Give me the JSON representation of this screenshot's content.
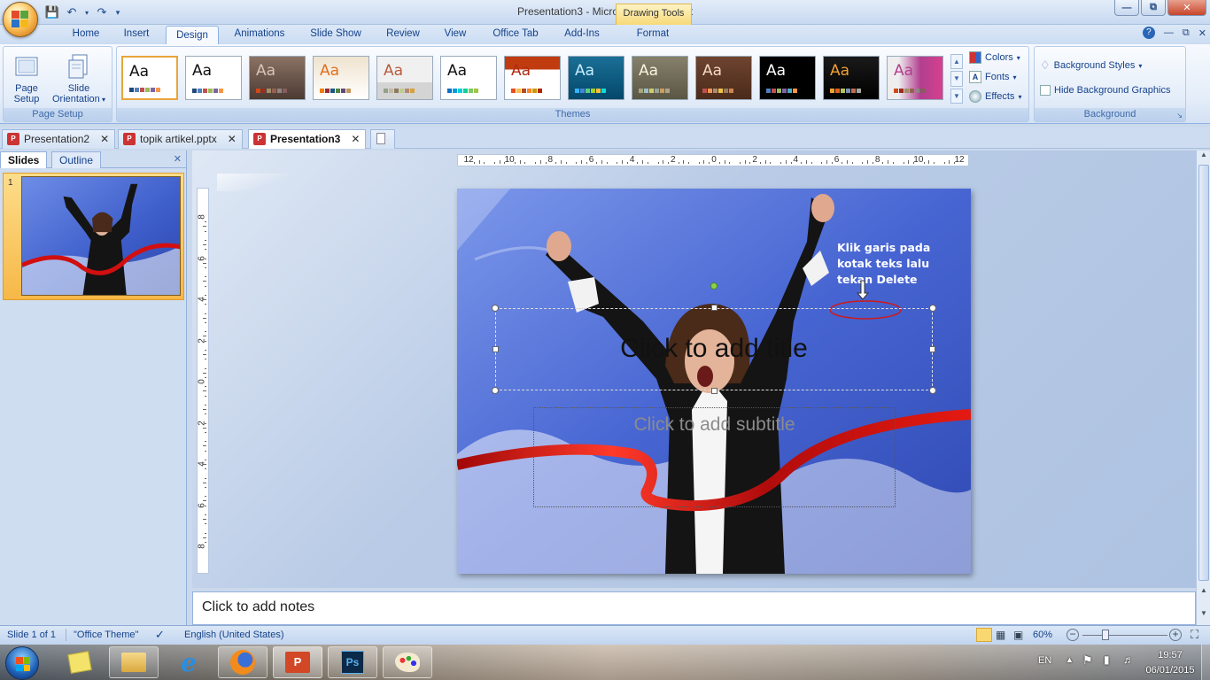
{
  "window": {
    "title": "Presentation3 - Microsoft PowerPoint",
    "contextual_header": "Drawing Tools"
  },
  "ribbon_tabs": [
    "Home",
    "Insert",
    "Design",
    "Animations",
    "Slide Show",
    "Review",
    "View",
    "Office Tab",
    "Add-Ins",
    "Format"
  ],
  "active_tab": "Design",
  "page_setup": {
    "page_setup_label": "Page Setup",
    "slide_orientation_label": "Slide Orientation",
    "group_label": "Page Setup"
  },
  "themes": {
    "group_label": "Themes",
    "sample_text": "Aa",
    "count": 13
  },
  "theme_options": {
    "colors": "Colors",
    "fonts": "Fonts",
    "effects": "Effects"
  },
  "background": {
    "styles": "Background Styles",
    "hide_graphics": "Hide Background Graphics",
    "group_label": "Background"
  },
  "doc_tabs": [
    {
      "label": "Presentation2"
    },
    {
      "label": "topik artikel.pptx"
    },
    {
      "label": "Presentation3"
    }
  ],
  "slides_pane": {
    "tab_slides": "Slides",
    "tab_outline": "Outline",
    "slide_number": "1"
  },
  "ruler": {
    "horizontal_labels": [
      "12",
      "10",
      "8",
      "6",
      "4",
      "2",
      "0",
      "2",
      "4",
      "6",
      "8",
      "10",
      "12"
    ],
    "vertical_labels": [
      "8",
      "6",
      "4",
      "2",
      "0",
      "2",
      "4",
      "6",
      "8"
    ]
  },
  "slide": {
    "title_placeholder": "Click to add title",
    "subtitle_placeholder": "Click to add subtitle",
    "annotation": "Klik garis pada kotak teks lalu tekan Delete"
  },
  "notes": {
    "placeholder": "Click to add notes"
  },
  "statusbar": {
    "slide_info": "Slide 1 of 1",
    "theme": "\"Office Theme\"",
    "language": "English (United States)",
    "zoom": "60%"
  },
  "taskbar": {
    "lang": "EN",
    "time": "19:57",
    "date": "06/01/2015"
  },
  "colors": {
    "accent": "#15428b",
    "slide_bg": "#4c6fd8",
    "ribbon_red": "#d10f0f"
  }
}
